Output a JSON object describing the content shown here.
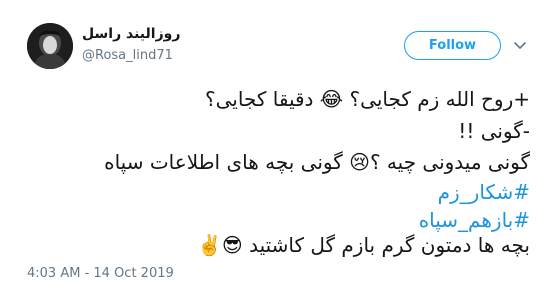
{
  "user": {
    "display_name": "روزالیند راسل",
    "handle": "@Rosa_lind71"
  },
  "follow_label": "Follow",
  "tweet": {
    "line1": "+روح الله زم کجایی؟ 😂 دقیقا کجایی؟",
    "line2": "-گونی !!",
    "line3": "گونی میدونی چیه ؟😢 گونی بچه های اطلاعات سپاه",
    "hashtag1": "#شکار_زم",
    "hashtag2": "#بازهم_سپاه",
    "line4": "بچه ها دمتون گرم بازم گل کاشتید 😎✌️"
  },
  "timestamp": "4:03 AM - 14 Oct 2019",
  "colors": {
    "accent": "#1da1f2",
    "hashtag": "#1b95e0",
    "muted": "#657786",
    "text": "#14171a"
  },
  "icons": [
    "avatar",
    "chevron-down-icon",
    "face-with-tears-of-joy-icon",
    "crying-face-icon",
    "sunglasses-face-icon",
    "victory-hand-icon"
  ]
}
